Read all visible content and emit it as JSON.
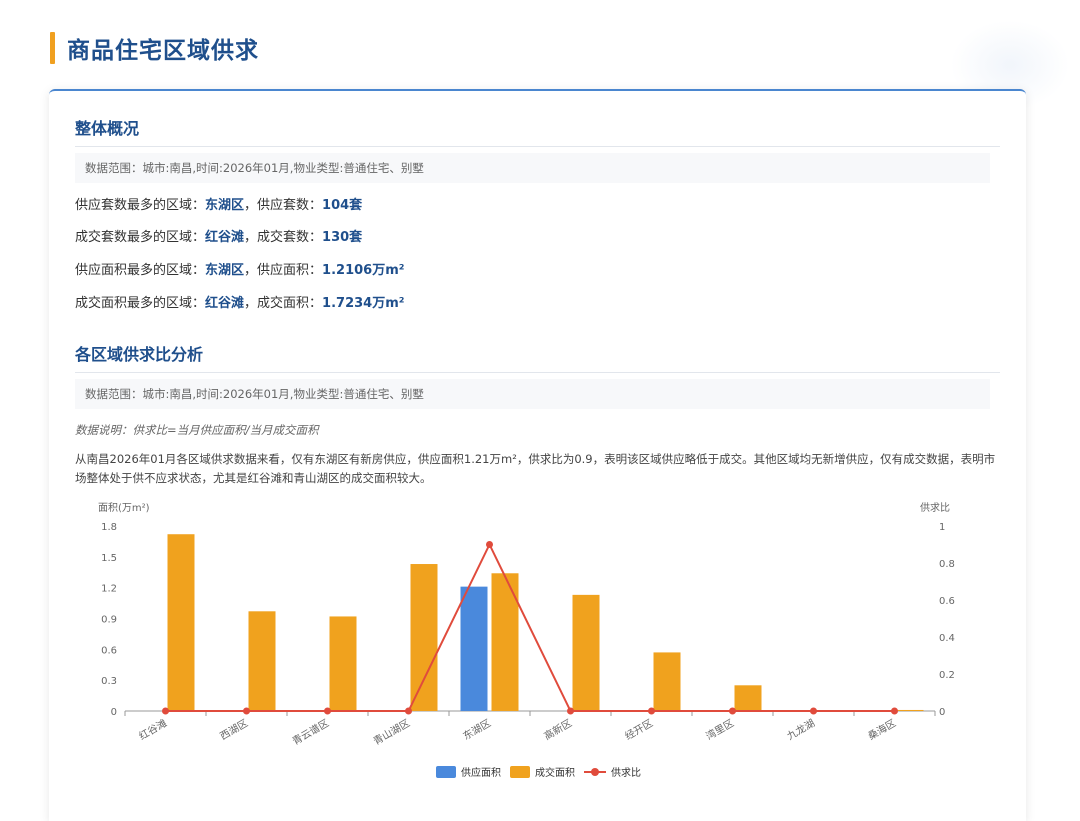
{
  "page": {
    "title": "商品住宅区域供求"
  },
  "overview": {
    "heading": "整体概况",
    "range": "数据范围：城市:南昌,时间:2026年01月,物业类型:普通住宅、别墅",
    "stats": [
      {
        "prefix": "供应套数最多的区域：",
        "region": "东湖区",
        "mid": "，供应套数：",
        "value": "104套"
      },
      {
        "prefix": "成交套数最多的区域：",
        "region": "红谷滩",
        "mid": "，成交套数：",
        "value": "130套"
      },
      {
        "prefix": "供应面积最多的区域：",
        "region": "东湖区",
        "mid": "，供应面积：",
        "value": "1.2106万m²"
      },
      {
        "prefix": "成交面积最多的区域：",
        "region": "红谷滩",
        "mid": "，成交面积：",
        "value": "1.7234万m²"
      }
    ]
  },
  "analysis": {
    "heading": "各区域供求比分析",
    "range": "数据范围：城市:南昌,时间:2026年01月,物业类型:普通住宅、别墅",
    "note": "数据说明：供求比=当月供应面积/当月成交面积",
    "description": "从南昌2026年01月各区域供求数据来看，仅有东湖区有新房供应，供应面积1.21万m²，供求比为0.9，表明该区域供应略低于成交。其他区域均无新增供应，仅有成交数据，表明市场整体处于供不应求状态，尤其是红谷滩和青山湖区的成交面积较大。"
  },
  "colors": {
    "supply": "#4a89dc",
    "deal": "#f0a21e",
    "ratio": "#e04b3c",
    "accent": "#f0a020",
    "heading": "#1f4f8c"
  },
  "chart_data": {
    "type": "bar",
    "categories": [
      "红谷滩",
      "西湖区",
      "青云谱区",
      "青山湖区",
      "东湖区",
      "高新区",
      "经开区",
      "湾里区",
      "九龙湖",
      "桑海区"
    ],
    "series": [
      {
        "name": "供应面积",
        "kind": "bar",
        "axis": "left",
        "values": [
          0,
          0,
          0,
          0,
          1.21,
          0,
          0,
          0,
          0,
          0
        ]
      },
      {
        "name": "成交面积",
        "kind": "bar",
        "axis": "left",
        "values": [
          1.72,
          0.97,
          0.92,
          1.43,
          1.34,
          1.13,
          0.57,
          0.25,
          0,
          0.01
        ]
      },
      {
        "name": "供求比",
        "kind": "line",
        "axis": "right",
        "values": [
          0,
          0,
          0,
          0,
          0.9,
          0,
          0,
          0,
          0,
          0
        ]
      }
    ],
    "ylabel": "面积(万m²)",
    "y2label": "供求比",
    "ylim": [
      0,
      1.8
    ],
    "yticks": [
      "0",
      "0.3",
      "0.6",
      "0.9",
      "1.2",
      "1.5",
      "1.8"
    ],
    "y2lim": [
      0,
      1
    ],
    "y2ticks": [
      "0",
      "0.2",
      "0.4",
      "0.6",
      "0.8",
      "1"
    ],
    "grid": false,
    "legend": "bottom-center"
  }
}
